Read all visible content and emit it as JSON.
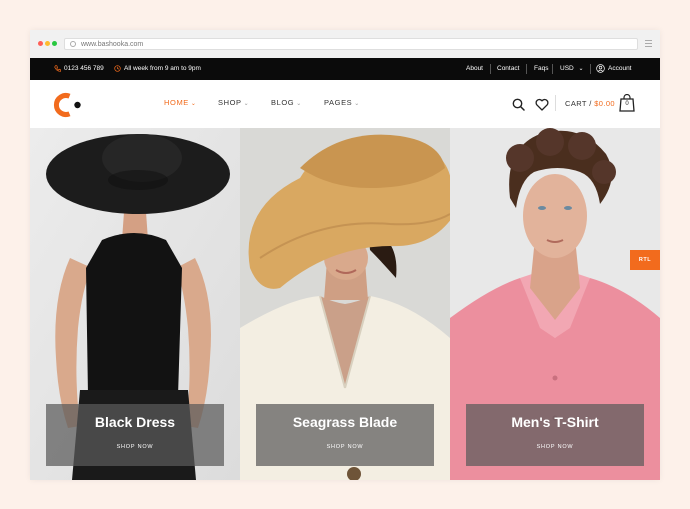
{
  "browser": {
    "url": "www.bashooka.com",
    "dot_colors": [
      "#ff5f57",
      "#febc2e",
      "#28c840"
    ]
  },
  "topbar": {
    "phone": "0123 456 789",
    "hours": "All week from 9 am to 9pm",
    "links": [
      "About",
      "Contact",
      "Faqs"
    ],
    "currency": "USD",
    "account": "Account"
  },
  "nav": {
    "items": [
      {
        "label": "HOME",
        "active": true
      },
      {
        "label": "SHOP",
        "active": false
      },
      {
        "label": "BLOG",
        "active": false
      },
      {
        "label": "PAGES",
        "active": false
      }
    ],
    "cart_label": "CART / ",
    "cart_total": "$0.00",
    "cart_count": "0"
  },
  "hero": {
    "panels": [
      {
        "title": "Black Dress",
        "cta": "SHOP NOW"
      },
      {
        "title": "Seagrass Blade",
        "cta": "SHOP NOW"
      },
      {
        "title": "Men's T-Shirt",
        "cta": "SHOP NOW"
      }
    ],
    "rtl_badge": "RTL"
  },
  "colors": {
    "accent": "#f26b1d",
    "topbar_bg": "#0b0b0b",
    "page_bg": "#fdf1ea"
  }
}
